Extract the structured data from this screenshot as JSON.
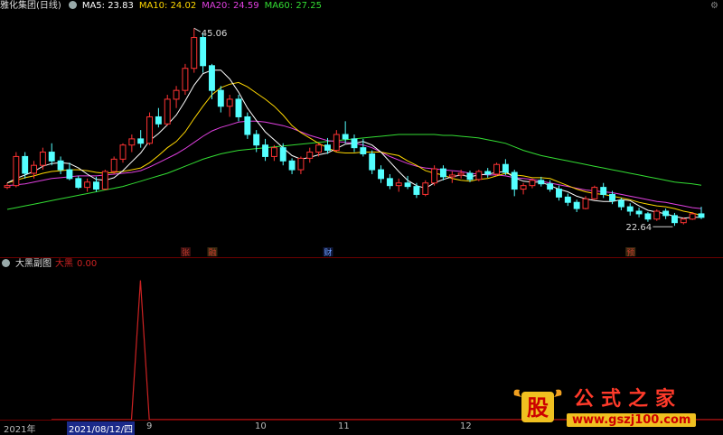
{
  "main_panel": {
    "stock_name": "雅化集团(日线)",
    "ma": [
      {
        "label": "MA5: 23.83",
        "color": "#ffffff"
      },
      {
        "label": "MA10: 24.02",
        "color": "#ffd700"
      },
      {
        "label": "MA20: 24.59",
        "color": "#e040e0"
      },
      {
        "label": "MA60: 27.25",
        "color": "#33dd33"
      }
    ],
    "high_label": "45.06",
    "low_label": "22.64",
    "markers": [
      {
        "text": "张",
        "color": "#c0392b",
        "bg": "#3a1010"
      },
      {
        "text": "融",
        "color": "#c0392b",
        "bg": "#3a2a10"
      },
      {
        "text": "财",
        "color": "#6a9cff",
        "bg": "#10183a"
      },
      {
        "text": "预",
        "color": "#c0392b",
        "bg": "#3a2a10"
      }
    ]
  },
  "sub_panel": {
    "title": "大黑副图",
    "indicator_label": "大黑",
    "indicator_value": "0.00"
  },
  "date_axis": {
    "year_label": "2021年",
    "selected_date": "2021/08/12/四",
    "months": [
      "9",
      "10",
      "11",
      "12"
    ]
  },
  "logo": {
    "word": "公式之家",
    "url": "www.gszj100.com",
    "mark_char": "股"
  },
  "colors": {
    "up": "#ff3333",
    "down": "#54ffff",
    "ma5": "#ffffff",
    "ma10": "#ffd700",
    "ma20": "#e040e0",
    "ma60": "#33dd33",
    "indicator": "#cc2222"
  },
  "chart_data": {
    "type": "candlestick",
    "y_range": [
      20,
      46
    ],
    "candles": [
      [
        27,
        27.5,
        26.8,
        27.2
      ],
      [
        27.2,
        31,
        27,
        30.5
      ],
      [
        30.5,
        31,
        28,
        28.6
      ],
      [
        28.6,
        30,
        28,
        29.5
      ],
      [
        29.5,
        31.5,
        29,
        31
      ],
      [
        31,
        32,
        29.5,
        30
      ],
      [
        30,
        30.5,
        28.5,
        29
      ],
      [
        29,
        29.8,
        27.8,
        28
      ],
      [
        28,
        28.3,
        26.8,
        27
      ],
      [
        27,
        28,
        26.5,
        27.6
      ],
      [
        27.6,
        28.2,
        26.5,
        26.8
      ],
      [
        26.8,
        29,
        26.7,
        28.8
      ],
      [
        28.8,
        30.5,
        28.5,
        30.2
      ],
      [
        30.2,
        32,
        29.8,
        31.8
      ],
      [
        31.8,
        33,
        31,
        32.5
      ],
      [
        32.5,
        33.5,
        31.5,
        32
      ],
      [
        32,
        35.5,
        31.8,
        35
      ],
      [
        35,
        36,
        33.8,
        34.2
      ],
      [
        34.2,
        37.5,
        34,
        37
      ],
      [
        37,
        38.5,
        36,
        38
      ],
      [
        38,
        41,
        37.5,
        40.5
      ],
      [
        40.5,
        45.06,
        40,
        44
      ],
      [
        44,
        44.5,
        40,
        40.8
      ],
      [
        40.8,
        41,
        37,
        38
      ],
      [
        38,
        38.5,
        35.5,
        36.2
      ],
      [
        36.2,
        37.5,
        35,
        37
      ],
      [
        37,
        37.5,
        34.5,
        35
      ],
      [
        35,
        35.5,
        32.5,
        33
      ],
      [
        33,
        33.5,
        31,
        31.8
      ],
      [
        31.8,
        32.5,
        30,
        30.5
      ],
      [
        30.5,
        31.8,
        30,
        31.5
      ],
      [
        31.5,
        32,
        29.5,
        30
      ],
      [
        30,
        30.3,
        28.5,
        29
      ],
      [
        29,
        30.5,
        28.5,
        30.3
      ],
      [
        30.3,
        31.5,
        29.8,
        31
      ],
      [
        31,
        32,
        30.5,
        31.8
      ],
      [
        31.8,
        32.6,
        30.8,
        31.2
      ],
      [
        31.2,
        33.5,
        31,
        33
      ],
      [
        33,
        34.5,
        32,
        32.5
      ],
      [
        32.5,
        33,
        31,
        31.5
      ],
      [
        31.5,
        32.5,
        30.5,
        30.8
      ],
      [
        30.8,
        31.2,
        28.5,
        29
      ],
      [
        29,
        29.5,
        27.5,
        28
      ],
      [
        28,
        28.5,
        26.8,
        27.2
      ],
      [
        27.2,
        28,
        26.5,
        27.5
      ],
      [
        27.5,
        28.3,
        26.8,
        27.1
      ],
      [
        27.1,
        27.5,
        25.8,
        26.2
      ],
      [
        26.2,
        27.8,
        26,
        27.5
      ],
      [
        27.5,
        29.5,
        27.2,
        29.1
      ],
      [
        29.1,
        29.5,
        27.8,
        28.2
      ],
      [
        28.2,
        28.8,
        27.5,
        28.4
      ],
      [
        28.4,
        29,
        28,
        28.6
      ],
      [
        28.6,
        28.9,
        27.6,
        27.9
      ],
      [
        27.9,
        29,
        27.7,
        28.8
      ],
      [
        28.8,
        29.2,
        28.1,
        28.5
      ],
      [
        28.5,
        29.8,
        28.3,
        29.6
      ],
      [
        29.6,
        30.2,
        28.4,
        28.7
      ],
      [
        28.7,
        29,
        26,
        26.8
      ],
      [
        26.8,
        27.5,
        26.2,
        27.2
      ],
      [
        27.2,
        28,
        26.9,
        27.8
      ],
      [
        27.8,
        28.2,
        27.1,
        27.4
      ],
      [
        27.4,
        27.8,
        26.5,
        26.8
      ],
      [
        26.8,
        27.2,
        25.5,
        25.9
      ],
      [
        25.9,
        26.3,
        24.9,
        25.3
      ],
      [
        25.3,
        25.6,
        24.2,
        24.6
      ],
      [
        24.6,
        26,
        24.5,
        25.7
      ],
      [
        25.7,
        27.2,
        25.6,
        27
      ],
      [
        27,
        27.5,
        25.8,
        26.2
      ],
      [
        26.2,
        26.6,
        25.1,
        25.5
      ],
      [
        25.5,
        25.8,
        24.4,
        24.8
      ],
      [
        24.8,
        25.2,
        23.8,
        24.3
      ],
      [
        24.3,
        24.7,
        23.6,
        24
      ],
      [
        24,
        24.2,
        23.1,
        23.4
      ],
      [
        23.4,
        24.5,
        23.2,
        24.3
      ],
      [
        24.3,
        24.6,
        23.4,
        23.8
      ],
      [
        23.8,
        24.1,
        22.64,
        23
      ],
      [
        23,
        23.6,
        22.8,
        23.4
      ],
      [
        23.4,
        24.2,
        23.3,
        24
      ],
      [
        24,
        24.8,
        23.4,
        23.6
      ]
    ],
    "ma5": [
      27.5,
      28,
      28.4,
      28.8,
      29.4,
      29.7,
      29.8,
      29.7,
      29.2,
      28.5,
      27.9,
      27.8,
      28.1,
      28.9,
      29.9,
      30.9,
      32.3,
      33.1,
      34.1,
      35.2,
      36.8,
      38.6,
      39.9,
      40.3,
      40.3,
      39.3,
      37.8,
      36,
      34.6,
      33.3,
      32.4,
      31.5,
      30.6,
      30.2,
      30.4,
      30.7,
      30.9,
      31.4,
      31.9,
      32,
      32.2,
      31.8,
      31,
      29.9,
      28.8,
      27.8,
      27.2,
      26.9,
      27.5,
      27.9,
      28.2,
      28.4,
      28.2,
      28.4,
      28.5,
      28.7,
      28.8,
      28.1,
      27.7,
      27.6,
      27.6,
      27.2,
      26.8,
      26.5,
      26,
      25.7,
      25.5,
      25.4,
      25.4,
      25.6,
      25.5,
      24.9,
      24.4,
      24.2,
      24,
      23.7,
      23.5,
      23.6,
      23.6
    ],
    "ma10": [
      27.5,
      27.8,
      28.1,
      28.3,
      28.6,
      28.8,
      28.9,
      29,
      29,
      28.9,
      28.7,
      28.6,
      28.7,
      28.8,
      29,
      29.2,
      29.8,
      30.6,
      31.5,
      32.2,
      33.3,
      34.8,
      36.2,
      37.5,
      38.3,
      38.7,
      38.9,
      38.4,
      37.7,
      37,
      36.2,
      35.2,
      34,
      33.2,
      32.6,
      32,
      31.5,
      31,
      30.9,
      30.9,
      31,
      31,
      31,
      30.8,
      30.6,
      30,
      29.5,
      28.9,
      28.6,
      28.4,
      28,
      27.8,
      27.7,
      27.9,
      28,
      28.3,
      28.6,
      28.4,
      28.3,
      28.1,
      28.1,
      28,
      27.6,
      27.2,
      26.8,
      26.5,
      26.3,
      26.2,
      26,
      25.8,
      25.6,
      25.3,
      25.1,
      24.9,
      24.8,
      24.6,
      24.3,
      24.1,
      23.8
    ],
    "ma20": [
      27.2,
      27.3,
      27.4,
      27.6,
      27.8,
      28,
      28.1,
      28.2,
      28.3,
      28.3,
      28.3,
      28.4,
      28.5,
      28.6,
      28.7,
      28.9,
      29.3,
      29.8,
      30.3,
      30.8,
      31.4,
      32.1,
      32.8,
      33.4,
      33.8,
      34.1,
      34.4,
      34.5,
      34.5,
      34.4,
      34.2,
      34,
      33.7,
      33.3,
      32.9,
      32.6,
      32.3,
      32.2,
      32.1,
      32,
      31.8,
      31.5,
      31,
      30.5,
      30.1,
      29.7,
      29.4,
      29.2,
      29.1,
      29,
      28.9,
      28.8,
      28.6,
      28.5,
      28.4,
      28.4,
      28.3,
      28.1,
      28,
      27.9,
      27.7,
      27.5,
      27.3,
      27.1,
      26.9,
      26.7,
      26.6,
      26.5,
      26.4,
      26.2,
      26,
      25.8,
      25.6,
      25.4,
      25.3,
      25.1,
      24.9,
      24.7,
      24.6
    ],
    "ma60": [
      24.5,
      24.7,
      24.9,
      25.1,
      25.3,
      25.5,
      25.7,
      25.9,
      26.1,
      26.3,
      26.5,
      26.7,
      26.9,
      27.1,
      27.4,
      27.7,
      28,
      28.3,
      28.6,
      29,
      29.4,
      29.8,
      30.2,
      30.5,
      30.8,
      31,
      31.2,
      31.3,
      31.4,
      31.5,
      31.6,
      31.7,
      31.8,
      31.9,
      32,
      32.1,
      32.2,
      32.3,
      32.4,
      32.5,
      32.6,
      32.7,
      32.8,
      32.9,
      33,
      33,
      33,
      33,
      33,
      32.9,
      32.9,
      32.8,
      32.7,
      32.6,
      32.4,
      32.2,
      32,
      31.6,
      31.2,
      30.9,
      30.6,
      30.4,
      30.2,
      30,
      29.8,
      29.6,
      29.4,
      29.2,
      29,
      28.8,
      28.6,
      28.4,
      28.2,
      28,
      27.8,
      27.6,
      27.5,
      27.4,
      27.25
    ],
    "indicator": {
      "name": "大黑",
      "spike_index": 10,
      "spike_value": 1,
      "baseline": 0,
      "y_range": [
        0,
        1.05
      ]
    }
  }
}
